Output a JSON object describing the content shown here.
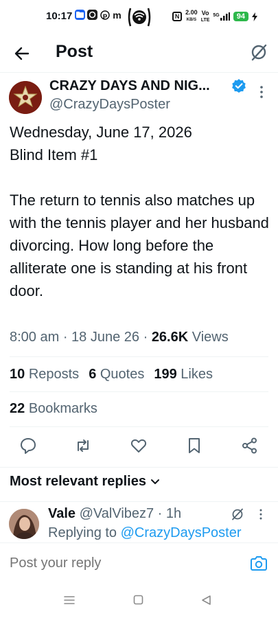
{
  "status_bar": {
    "time": "10:17",
    "app_m": "m",
    "speed_value": "2.00",
    "speed_unit": "KB/S",
    "volte": "Vo",
    "lte": "LTE",
    "network": "5G",
    "battery": "94"
  },
  "header": {
    "title": "Post"
  },
  "tweet": {
    "author_name": "CRAZY DAYS AND NIG...",
    "author_handle": "@CrazyDaysPoster",
    "text": "Wednesday, June 17, 2026\nBlind Item #1\n\nThe return to tennis also matches up with the tennis player and her husband divorcing. How long before the alliterate one is standing at his front door.",
    "time": "8:00 am",
    "date": "18 June 26",
    "views_count": "26.6K",
    "views_label": "Views",
    "reposts_count": "10",
    "reposts_label": "Reposts",
    "quotes_count": "6",
    "quotes_label": "Quotes",
    "likes_count": "199",
    "likes_label": "Likes",
    "bookmarks_count": "22",
    "bookmarks_label": "Bookmarks"
  },
  "replies": {
    "heading": "Most relevant replies",
    "items": [
      {
        "name": "Vale",
        "handle": "@ValVibez7",
        "age": "1h",
        "replying_prefix": "Replying to",
        "replying_handle": "@CrazyDaysPoster"
      }
    ]
  },
  "composer": {
    "placeholder": "Post your reply"
  },
  "colors": {
    "accent": "#1d9bf0",
    "secondary_text": "#536471",
    "primary_text": "#0f1419",
    "battery": "#2db84b"
  }
}
